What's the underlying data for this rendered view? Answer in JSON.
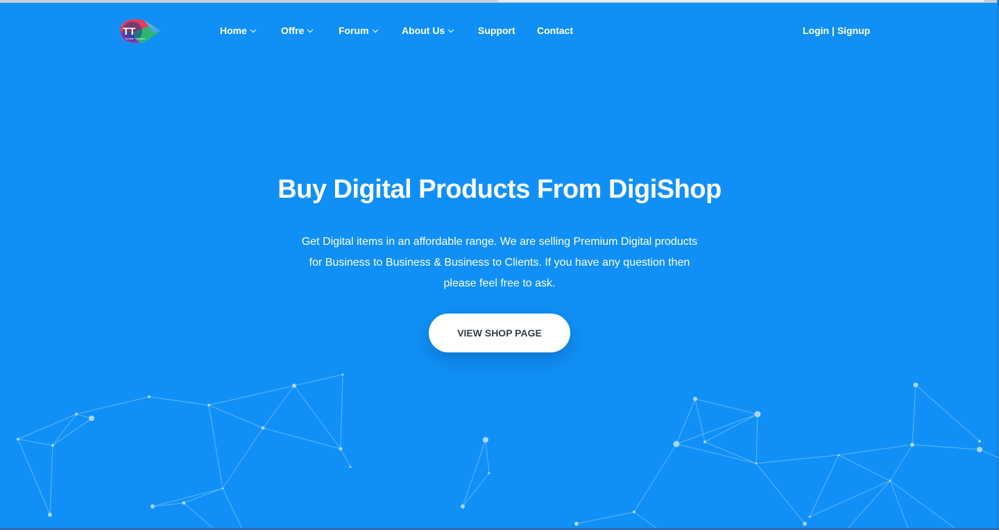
{
  "brand": {
    "logo_text": "TT",
    "logo_subtext": "Tunisie Telecom"
  },
  "nav": {
    "items": [
      {
        "label": "Home",
        "has_dropdown": true
      },
      {
        "label": "Offre",
        "has_dropdown": true
      },
      {
        "label": "Forum",
        "has_dropdown": true
      },
      {
        "label": "About Us",
        "has_dropdown": true
      },
      {
        "label": "Support",
        "has_dropdown": false
      },
      {
        "label": "Contact",
        "has_dropdown": false
      }
    ],
    "login_label": "Login",
    "separator": "|",
    "signup_label": "Signup"
  },
  "hero": {
    "title": "Buy Digital Products From DigiShop",
    "description_line1": "Get Digital items in an affordable range. We are selling Premium Digital products",
    "description_line2": "for Business to Business & Business to Clients. If you have any question then",
    "description_line3": "please feel free to ask.",
    "cta_label": "VIEW SHOP PAGE"
  },
  "colors": {
    "background": "#1090f6",
    "text": "#ffffff",
    "button_bg": "#ffffff",
    "button_text": "#333b44"
  }
}
